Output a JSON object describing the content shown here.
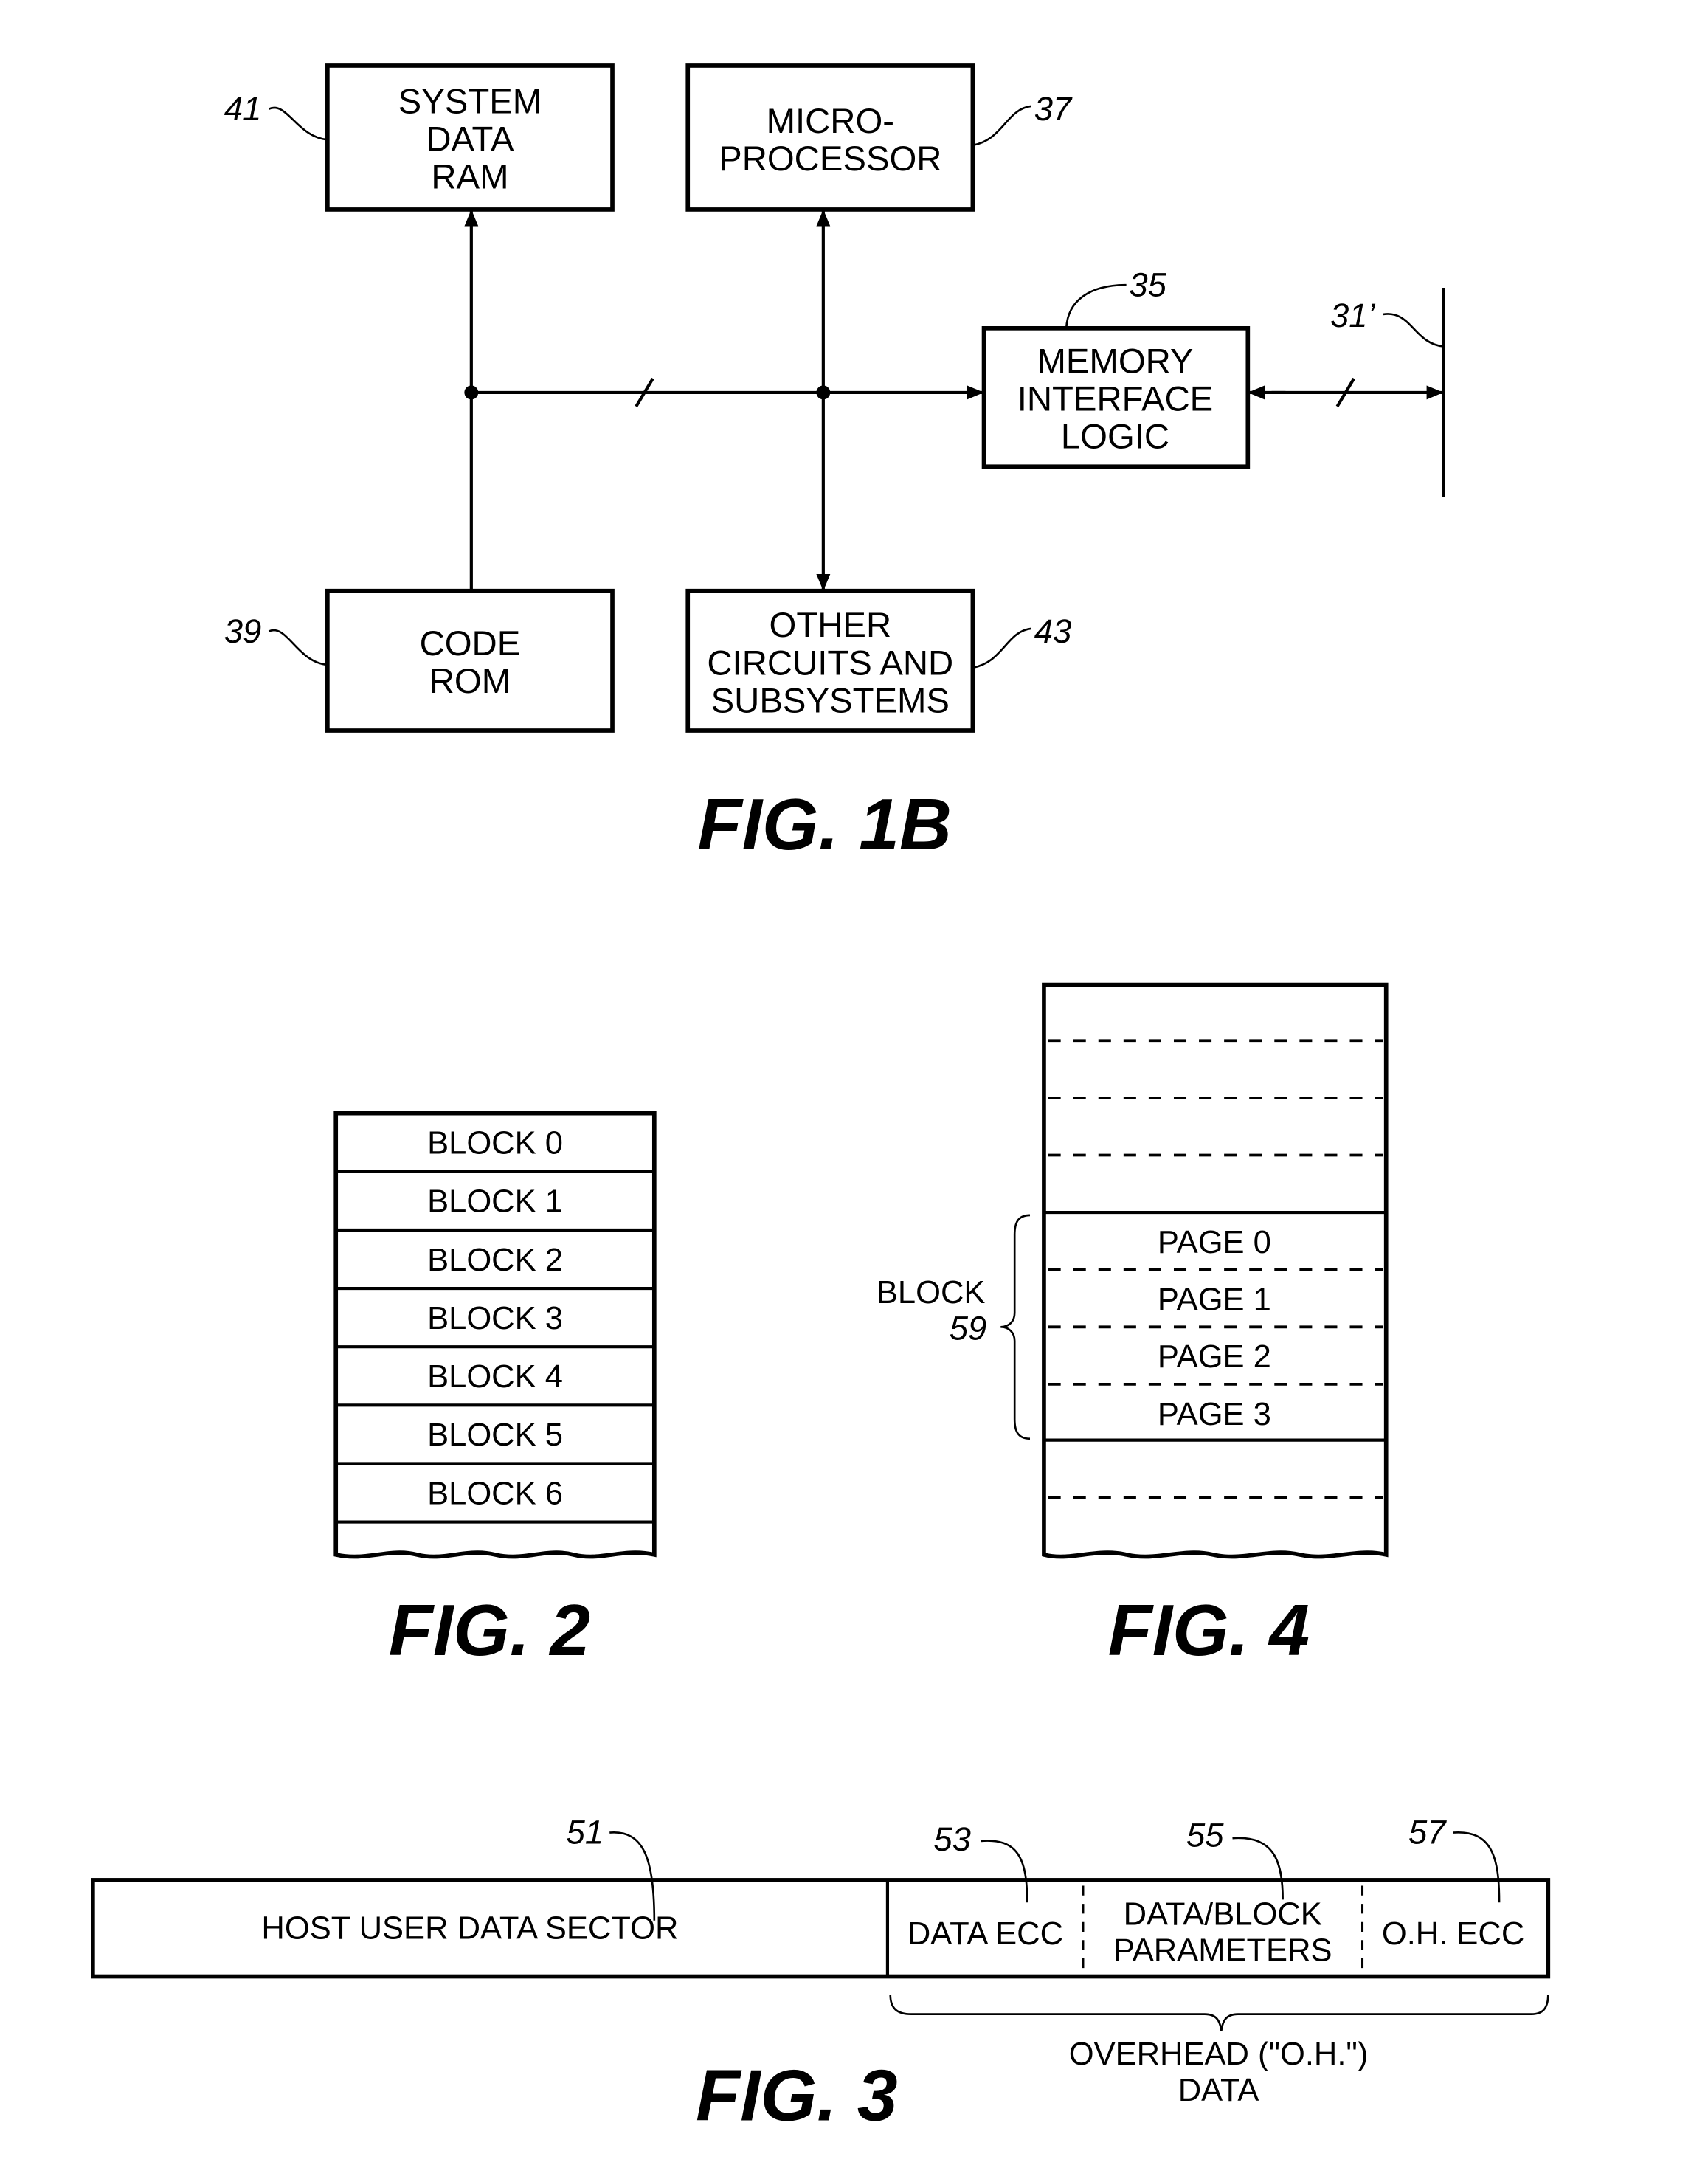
{
  "fig1b": {
    "caption": "FIG. 1B",
    "system_data_ram": {
      "lines": [
        "SYSTEM",
        "DATA",
        "RAM"
      ],
      "ref": "41"
    },
    "microprocessor": {
      "lines": [
        "MICRO-",
        "PROCESSOR"
      ],
      "ref": "37"
    },
    "memory_interface_logic": {
      "lines": [
        "MEMORY",
        "INTERFACE",
        "LOGIC"
      ],
      "ref": "35"
    },
    "code_rom": {
      "lines": [
        "CODE",
        "ROM"
      ],
      "ref": "39"
    },
    "other_circuits": {
      "lines": [
        "OTHER",
        "CIRCUITS AND",
        "SUBSYSTEMS"
      ],
      "ref": "43"
    },
    "bus_ref": "31’"
  },
  "fig2": {
    "caption": "FIG. 2",
    "blocks": [
      "BLOCK 0",
      "BLOCK 1",
      "BLOCK 2",
      "BLOCK 3",
      "BLOCK 4",
      "BLOCK 5",
      "BLOCK 6"
    ]
  },
  "fig4": {
    "caption": "FIG. 4",
    "pages": [
      "PAGE 0",
      "PAGE 1",
      "PAGE 2",
      "PAGE 3"
    ],
    "block_label": "BLOCK",
    "block_ref": "59"
  },
  "fig3": {
    "caption": "FIG. 3",
    "host_user_data_sector": {
      "label": "HOST USER DATA SECTOR",
      "ref": "51"
    },
    "data_ecc": {
      "label": "DATA ECC",
      "ref": "53"
    },
    "data_block_parameters": {
      "lines": [
        "DATA/BLOCK",
        "PARAMETERS"
      ],
      "ref": "55"
    },
    "oh_ecc": {
      "label": "O.H. ECC",
      "ref": "57"
    },
    "overhead_lines": [
      "OVERHEAD (\"O.H.\")",
      "DATA"
    ]
  }
}
